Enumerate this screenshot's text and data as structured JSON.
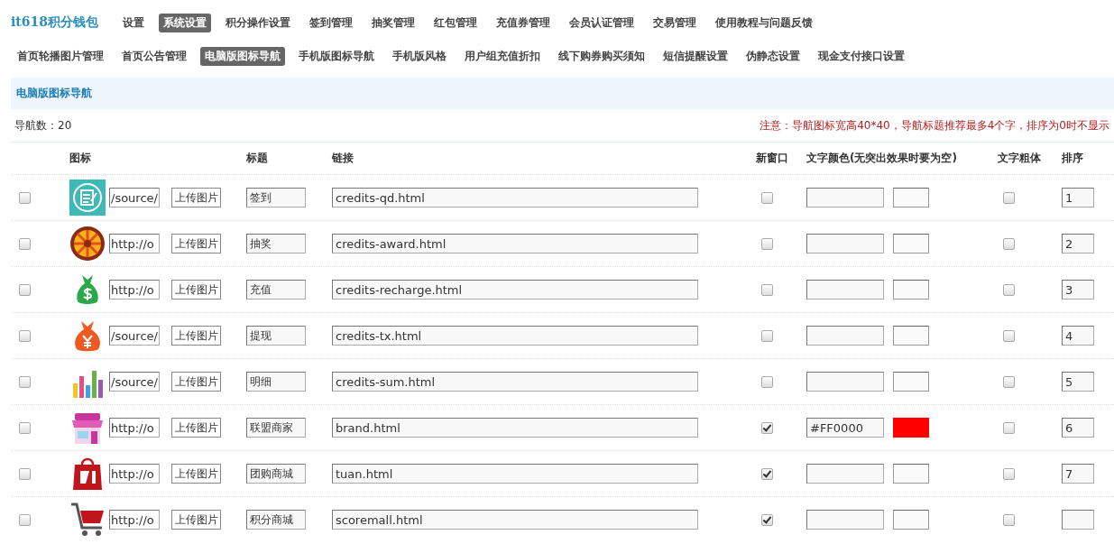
{
  "brand": "it618积分钱包",
  "nav": [
    {
      "label": "设置",
      "selected": false
    },
    {
      "label": "系统设置",
      "selected": true
    },
    {
      "label": "积分操作设置",
      "selected": false
    },
    {
      "label": "签到管理",
      "selected": false
    },
    {
      "label": "抽奖管理",
      "selected": false
    },
    {
      "label": "红包管理",
      "selected": false
    },
    {
      "label": "充值券管理",
      "selected": false
    },
    {
      "label": "会员认证管理",
      "selected": false
    },
    {
      "label": "交易管理",
      "selected": false
    },
    {
      "label": "使用教程与问题反馈",
      "selected": false
    }
  ],
  "subnav": [
    {
      "label": "首页轮播图片管理",
      "selected": false
    },
    {
      "label": "首页公告管理",
      "selected": false
    },
    {
      "label": "电脑版图标导航",
      "selected": true
    },
    {
      "label": "手机版图标导航",
      "selected": false
    },
    {
      "label": "手机版风格",
      "selected": false
    },
    {
      "label": "用户组充值折扣",
      "selected": false
    },
    {
      "label": "线下购券购买须知",
      "selected": false
    },
    {
      "label": "短信提醒设置",
      "selected": false
    },
    {
      "label": "伪静态设置",
      "selected": false
    },
    {
      "label": "现金支付接口设置",
      "selected": false
    }
  ],
  "section_title": "电脑版图标导航",
  "count": "导航数：20",
  "notice": "注意：导航图标宽高40*40，导航标题推荐最多4个字，排序为0时不显示",
  "columns": {
    "icon": "图标",
    "title": "标题",
    "link": "链接",
    "new_window": "新窗口",
    "text_color": "文字颜色(无突出效果时要为空)",
    "bold": "文字粗体",
    "order": "排序"
  },
  "rows": [
    {
      "checked": false,
      "url": "/source/",
      "upload_label": "上传图片",
      "title": "签到",
      "link": "credits-qd.html",
      "new_window": false,
      "bold": false,
      "order": "1"
    },
    {
      "checked": false,
      "url": "http://o",
      "upload_label": "上传图片",
      "title": "抽奖",
      "link": "credits-award.html",
      "new_window": false,
      "bold": false,
      "order": "2"
    },
    {
      "checked": false,
      "url": "http://o",
      "upload_label": "上传图片",
      "title": "充值",
      "link": "credits-recharge.html",
      "new_window": false,
      "bold": false,
      "order": "3"
    },
    {
      "checked": false,
      "url": "/source/",
      "upload_label": "上传图片",
      "title": "提现",
      "link": "credits-tx.html",
      "new_window": false,
      "bold": false,
      "order": "4"
    },
    {
      "checked": false,
      "url": "/source/",
      "upload_label": "上传图片",
      "title": "明细",
      "link": "credits-sum.html",
      "new_window": false,
      "bold": false,
      "order": "5"
    },
    {
      "checked": false,
      "url": "http://o",
      "upload_label": "上传图片",
      "title": "联盟商家",
      "link": "brand.html",
      "new_window": true,
      "text_color": "#FF0000",
      "bold": false,
      "order": "6"
    },
    {
      "checked": false,
      "url": "http://o",
      "upload_label": "上传图片",
      "title": "团购商城",
      "link": "tuan.html",
      "new_window": true,
      "bold": false,
      "order": "7"
    },
    {
      "checked": false,
      "url": "http://o",
      "upload_label": "上传图片",
      "title": "积分商城",
      "link": "scoremall.html",
      "new_window": true,
      "bold": false
    }
  ]
}
